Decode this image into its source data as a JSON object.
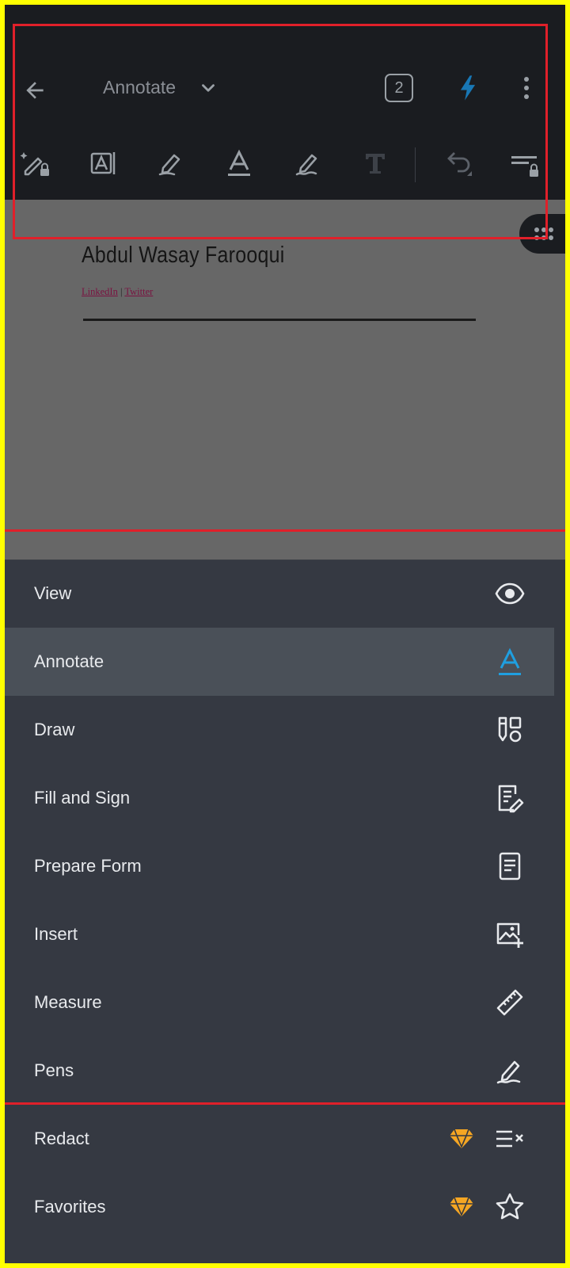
{
  "appbar": {
    "mode_title": "Annotate",
    "page_count": "2",
    "colors": {
      "background": "#1a1c20",
      "icon": "#9aa0a6",
      "accent": "#1877b5"
    },
    "top_icons": [
      "back-arrow-icon",
      "chevron-down-icon",
      "page-count-badge",
      "lightning-icon",
      "more-vertical-icon"
    ],
    "tools": [
      "magic-pencil-lock-icon",
      "text-select-icon",
      "highlighter-icon",
      "text-underline-icon",
      "free-hand-pen-icon",
      "free-text-icon",
      "undo-icon",
      "toolbar-settings-lock-icon"
    ]
  },
  "document": {
    "name": "Abdul Wasay Farooqui",
    "link_1": "LinkedIn",
    "separator": "|",
    "link_2": "Twitter"
  },
  "menu": {
    "items": [
      {
        "label": "View",
        "icon": "eye-icon",
        "active": false
      },
      {
        "label": "Annotate",
        "icon": "annotate-a-icon",
        "active": true
      },
      {
        "label": "Draw",
        "icon": "draw-shapes-icon",
        "active": false
      },
      {
        "label": "Fill and Sign",
        "icon": "fill-sign-icon",
        "active": false
      },
      {
        "label": "Prepare Form",
        "icon": "form-document-icon",
        "active": false
      },
      {
        "label": "Insert",
        "icon": "insert-image-icon",
        "active": false
      },
      {
        "label": "Measure",
        "icon": "ruler-icon",
        "active": false
      },
      {
        "label": "Pens",
        "icon": "pen-icon",
        "active": false
      },
      {
        "label": "Redact",
        "icon": "redact-icon",
        "active": false,
        "premium": true
      },
      {
        "label": "Favorites",
        "icon": "star-icon",
        "active": false,
        "premium": true
      }
    ],
    "colors": {
      "sheet": "#353942",
      "active": "#4a5058",
      "text": "#e8eaed",
      "accent": "#1f9fe0",
      "premium": "#f5a623"
    }
  }
}
